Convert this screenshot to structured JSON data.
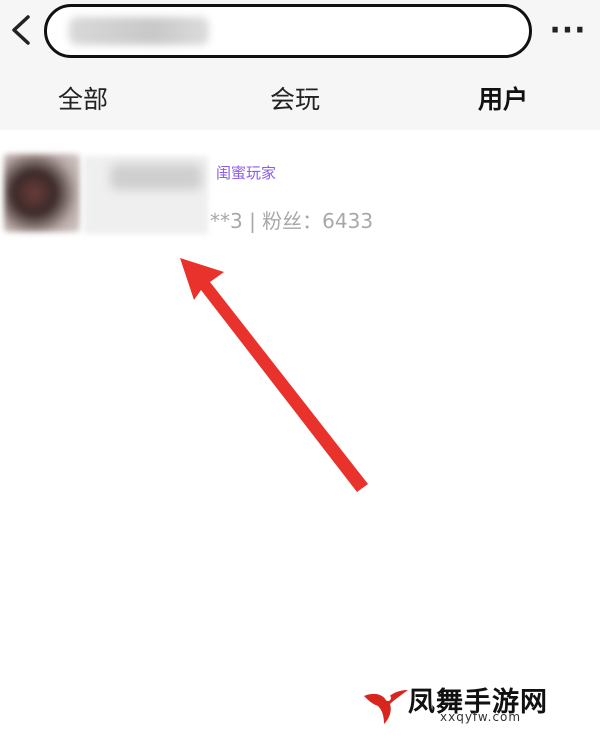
{
  "header": {
    "back_icon": "chevron-left-icon",
    "search": {
      "value": ""
    },
    "more_label": "···"
  },
  "tabs": [
    {
      "label": "全部",
      "active": false
    },
    {
      "label": "会玩",
      "active": false
    },
    {
      "label": "用户",
      "active": true
    }
  ],
  "colors": {
    "active_tab_underline": "#ffe400",
    "badge": "#8a5cf0",
    "meta_text": "#a8a8a8",
    "annotation_arrow": "#e8322b"
  },
  "results": [
    {
      "badge": "闺蜜玩家",
      "meta": "**3 | 粉丝：6433"
    }
  ],
  "watermark": {
    "title": "凤舞手游网",
    "url": "xxqyfw.com"
  }
}
